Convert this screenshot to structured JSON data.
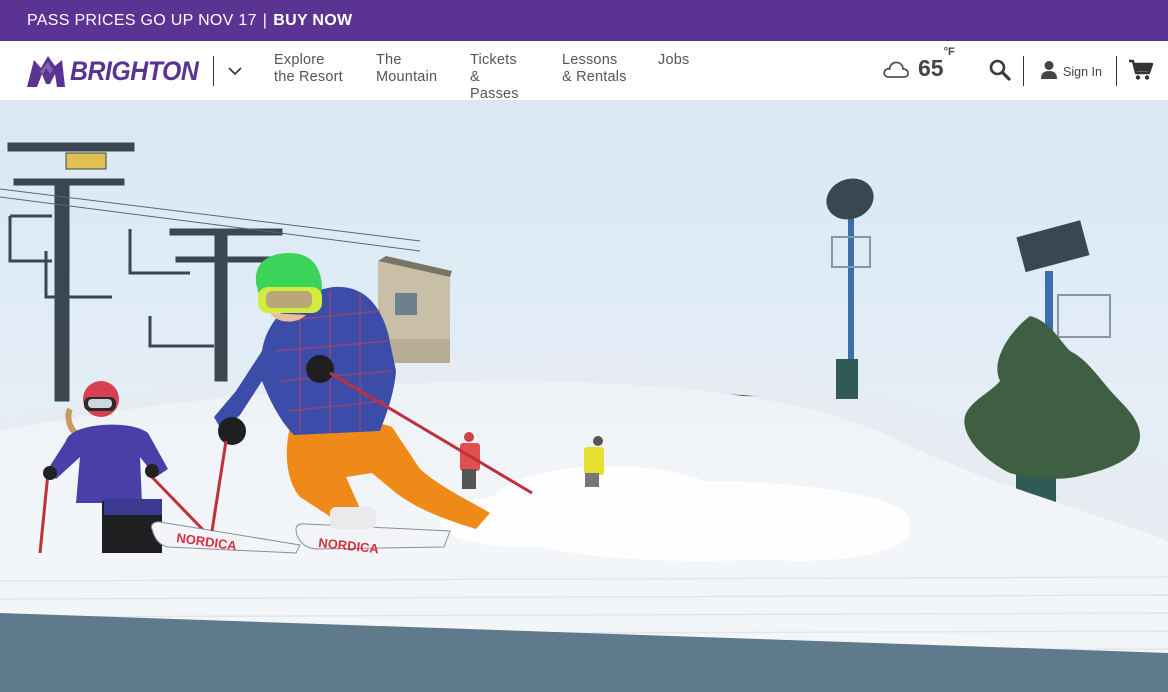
{
  "promo": {
    "text": "PASS PRICES GO UP NOV 17",
    "separator": "|",
    "cta": "BUY NOW"
  },
  "header": {
    "brand": "BRIGHTON",
    "nav": [
      {
        "label": "Explore\nthe Resort"
      },
      {
        "label": "The\nMountain"
      },
      {
        "label": "Tickets\n& Passes"
      },
      {
        "label": "Lessons\n& Rentals"
      },
      {
        "label": "Jobs"
      }
    ],
    "weather": {
      "temperature": "65",
      "unit": "°F",
      "icon": "cloud-icon"
    },
    "signin_label": "Sign In",
    "icons": {
      "search": "search-icon",
      "user": "user-icon",
      "cart": "cart-icon",
      "menu": "chevron-down-icon"
    }
  },
  "hero": {
    "ski_brand": "NORDICA",
    "colors": {
      "sky": "#e2edf6",
      "snow": "#f4f7fa",
      "jacket": "#3b4da8",
      "pants": "#f08a1c",
      "helmet": "#3bd35a",
      "band": "#5f7a8a"
    }
  },
  "theme": {
    "brand_purple": "#5b3393",
    "text_gray": "#555555"
  }
}
